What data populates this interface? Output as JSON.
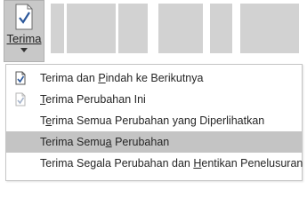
{
  "ribbon": {
    "accept_button": {
      "label": "Terima",
      "icon": "document-check-icon"
    }
  },
  "menu": {
    "items": [
      {
        "pre": "Terima dan ",
        "key": "P",
        "post": "indah ke Berikutnya",
        "icon": "document-check-icon",
        "selected": false
      },
      {
        "pre": "",
        "key": "T",
        "post": "erima Perubahan Ini",
        "icon": "document-check-faded-icon",
        "selected": false
      },
      {
        "pre": "T",
        "key": "e",
        "post": "rima Semua Perubahan yang Diperlihatkan",
        "icon": "",
        "selected": false
      },
      {
        "pre": "Terima Semu",
        "key": "a",
        "post": " Perubahan",
        "icon": "",
        "selected": true
      },
      {
        "pre": "Terima Segala Perubahan dan ",
        "key": "H",
        "post": "entikan Penelusuran",
        "icon": "",
        "selected": false
      }
    ]
  },
  "colors": {
    "selected_bg": "#c4c4c4",
    "accent_check": "#2b579a"
  }
}
